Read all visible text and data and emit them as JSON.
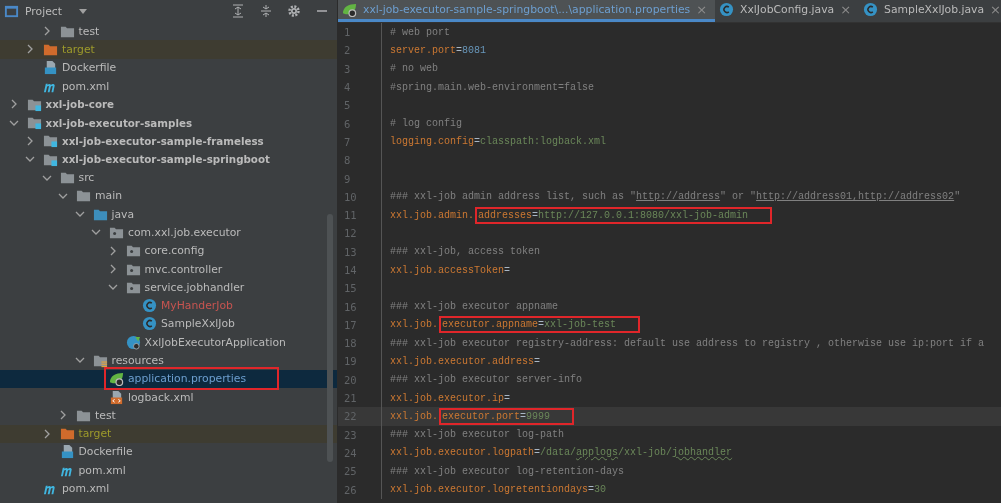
{
  "project_panel": {
    "title": "Project",
    "tree": [
      {
        "kind": "offscreen",
        "children": [
          {
            "kind": "offscreen",
            "children": [
              {
                "kind": "offscreen",
                "children": [
                  {
                    "kind": "folder",
                    "label": "test",
                    "expanded": false,
                    "selected": false,
                    "marked": false
                  }
                ]
              },
              {
                "kind": "target",
                "label": "target",
                "expanded": false,
                "selected": false,
                "marked": false
              },
              {
                "kind": "docker",
                "label": "Dockerfile",
                "selected": false,
                "marked": false
              },
              {
                "kind": "maven",
                "label": "pom.xml",
                "selected": false,
                "marked": false
              }
            ]
          },
          {
            "kind": "module",
            "label": "xxl-job-core",
            "expanded": false,
            "selected": false,
            "marked": false
          },
          {
            "kind": "module",
            "label": "xxl-job-executor-samples",
            "expanded": true,
            "selected": false,
            "marked": false,
            "children": [
              {
                "kind": "module",
                "label": "xxl-job-executor-sample-frameless",
                "expanded": false,
                "selected": false,
                "marked": false
              },
              {
                "kind": "module",
                "label": "xxl-job-executor-sample-springboot",
                "expanded": true,
                "selected": false,
                "marked": false,
                "children": [
                  {
                    "kind": "folder",
                    "label": "src",
                    "expanded": true,
                    "selected": false,
                    "marked": false,
                    "children": [
                      {
                        "kind": "folder",
                        "label": "main",
                        "expanded": true,
                        "selected": false,
                        "marked": false,
                        "children": [
                          {
                            "kind": "source",
                            "label": "java",
                            "expanded": true,
                            "selected": false,
                            "marked": false,
                            "children": [
                              {
                                "kind": "package",
                                "label": "com.xxl.job.executor",
                                "expanded": true,
                                "selected": false,
                                "marked": false,
                                "children": [
                                  {
                                    "kind": "package",
                                    "label": "core.config",
                                    "expanded": false,
                                    "selected": false,
                                    "marked": false
                                  },
                                  {
                                    "kind": "package",
                                    "label": "mvc.controller",
                                    "expanded": false,
                                    "selected": false,
                                    "marked": false
                                  },
                                  {
                                    "kind": "package",
                                    "label": "service.jobhandler",
                                    "expanded": true,
                                    "selected": false,
                                    "marked": false,
                                    "children": [
                                      {
                                        "kind": "class-new",
                                        "label": "MyHanderJob",
                                        "selected": false,
                                        "marked": false
                                      },
                                      {
                                        "kind": "class",
                                        "label": "SampleXxlJob",
                                        "selected": false,
                                        "marked": false
                                      }
                                    ]
                                  },
                                  {
                                    "kind": "spring-app",
                                    "label": "XxlJobExecutorApplication",
                                    "selected": false,
                                    "marked": false
                                  }
                                ]
                              }
                            ]
                          },
                          {
                            "kind": "resources",
                            "label": "resources",
                            "expanded": true,
                            "selected": false,
                            "marked": false,
                            "children": [
                              {
                                "kind": "properties",
                                "label": "application.properties",
                                "selected": true,
                                "marked": true
                              },
                              {
                                "kind": "xml",
                                "label": "logback.xml",
                                "selected": false,
                                "marked": false
                              }
                            ]
                          }
                        ]
                      },
                      {
                        "kind": "folder",
                        "label": "test",
                        "expanded": false,
                        "selected": false,
                        "marked": false
                      }
                    ]
                  },
                  {
                    "kind": "target",
                    "label": "target",
                    "expanded": false,
                    "selected": false,
                    "marked": false
                  },
                  {
                    "kind": "docker",
                    "label": "Dockerfile",
                    "selected": false,
                    "marked": false
                  },
                  {
                    "kind": "maven",
                    "label": "pom.xml",
                    "selected": false,
                    "marked": false
                  }
                ]
              },
              {
                "kind": "maven",
                "label": "pom.xml",
                "selected": false,
                "marked": false
              }
            ]
          }
        ]
      }
    ]
  },
  "editor": {
    "tabs": [
      {
        "kind": "properties",
        "label": "xxl-job-executor-sample-springboot\\...\\application.properties",
        "close": "×",
        "selected": true
      },
      {
        "kind": "class",
        "label": "XxlJobConfig.java",
        "close": "×",
        "selected": false
      },
      {
        "kind": "class",
        "label": "SampleXxlJob.java",
        "close": "×",
        "selected": false
      }
    ],
    "lines": [
      {
        "number": "1",
        "current": false,
        "tokens": [
          {
            "kind": "comment",
            "text": "# web port"
          }
        ]
      },
      {
        "number": "2",
        "current": false,
        "tokens": [
          {
            "kind": "key",
            "text": "server.port"
          },
          {
            "kind": "op",
            "text": "="
          },
          {
            "kind": "number",
            "text": "8081"
          }
        ]
      },
      {
        "number": "3",
        "current": false,
        "tokens": [
          {
            "kind": "comment",
            "text": "# no web"
          }
        ]
      },
      {
        "number": "4",
        "current": false,
        "tokens": [
          {
            "kind": "comment",
            "text": "#spring.main.web-environment=false"
          }
        ]
      },
      {
        "number": "5",
        "current": false
      },
      {
        "number": "6",
        "current": false,
        "tokens": [
          {
            "kind": "comment",
            "text": "# log config"
          }
        ]
      },
      {
        "number": "7",
        "current": false,
        "tokens": [
          {
            "kind": "key",
            "text": "logging.config"
          },
          {
            "kind": "op",
            "text": "="
          },
          {
            "kind": "value",
            "text": "classpath:logback.xml"
          }
        ]
      },
      {
        "number": "8",
        "current": false
      },
      {
        "number": "9",
        "current": false
      },
      {
        "number": "10",
        "current": false,
        "tokens": [
          {
            "kind": "comment",
            "text": "### xxl-job admin address list, such as \""
          },
          {
            "kind": "link",
            "text": "http://address"
          },
          {
            "kind": "comment",
            "text": "\" or \""
          },
          {
            "kind": "link",
            "text": "http://address01,http://address02"
          },
          {
            "kind": "comment",
            "text": "\""
          }
        ]
      },
      {
        "number": "11",
        "current": false,
        "tokens": [
          {
            "kind": "key",
            "text": "xxl.job.admin."
          },
          {
            "kind": "marked",
            "tokens": [
              {
                "kind": "key",
                "text": "addresses"
              },
              {
                "kind": "op",
                "text": "="
              },
              {
                "kind": "value",
                "text": "http://127.0.0.1:8080/xxl-job-admin"
              }
            ]
          }
        ]
      },
      {
        "number": "12",
        "current": false
      },
      {
        "number": "13",
        "current": false,
        "tokens": [
          {
            "kind": "comment",
            "text": "### xxl-job, access token"
          }
        ]
      },
      {
        "number": "14",
        "current": false,
        "tokens": [
          {
            "kind": "key",
            "text": "xxl.job.accessToken"
          },
          {
            "kind": "op",
            "text": "="
          }
        ]
      },
      {
        "number": "15",
        "current": false
      },
      {
        "number": "16",
        "current": false,
        "tokens": [
          {
            "kind": "comment",
            "text": "### xxl-job executor appname"
          }
        ]
      },
      {
        "number": "17",
        "current": false,
        "tokens": [
          {
            "kind": "key",
            "text": "xxl.job."
          },
          {
            "kind": "marked",
            "tokens": [
              {
                "kind": "key",
                "text": "executor.appname"
              },
              {
                "kind": "op",
                "text": "="
              },
              {
                "kind": "value",
                "text": "xxl-job-test"
              }
            ]
          }
        ]
      },
      {
        "number": "18",
        "current": false,
        "tokens": [
          {
            "kind": "comment",
            "text": "### xxl-job executor registry-address: default use address to registry , otherwise use ip:port if a"
          }
        ]
      },
      {
        "number": "19",
        "current": false,
        "tokens": [
          {
            "kind": "key",
            "text": "xxl.job.executor.address"
          },
          {
            "kind": "op",
            "text": "="
          }
        ]
      },
      {
        "number": "20",
        "current": false,
        "tokens": [
          {
            "kind": "comment",
            "text": "### xxl-job executor server-info"
          }
        ]
      },
      {
        "number": "21",
        "current": false,
        "tokens": [
          {
            "kind": "key",
            "text": "xxl.job.executor.ip"
          },
          {
            "kind": "op",
            "text": "="
          }
        ]
      },
      {
        "number": "22",
        "current": true,
        "tokens": [
          {
            "kind": "key",
            "text": "xxl.job."
          },
          {
            "kind": "marked",
            "tokens": [
              {
                "kind": "key",
                "text": "executor.port"
              },
              {
                "kind": "op",
                "text": "="
              },
              {
                "kind": "value",
                "text": "9999"
              }
            ]
          }
        ]
      },
      {
        "number": "23",
        "current": false,
        "tokens": [
          {
            "kind": "comment",
            "text": "### xxl-job executor log-path"
          }
        ]
      },
      {
        "number": "24",
        "current": false,
        "tokens": [
          {
            "kind": "key",
            "text": "xxl.job.executor.logpath"
          },
          {
            "kind": "op",
            "text": "="
          },
          {
            "kind": "value",
            "text": "/data/"
          },
          {
            "kind": "typo",
            "text": "applogs"
          },
          {
            "kind": "value",
            "text": "/xxl-job/"
          },
          {
            "kind": "typo",
            "text": "jobhandler"
          }
        ]
      },
      {
        "number": "25",
        "current": false,
        "tokens": [
          {
            "kind": "comment",
            "text": "### xxl-job executor log-retention-days"
          }
        ]
      },
      {
        "number": "26",
        "current": false,
        "tokens": [
          {
            "kind": "key",
            "text": "xxl.job.executor.logretentiondays"
          },
          {
            "kind": "op",
            "text": "="
          },
          {
            "kind": "value",
            "text": "30"
          }
        ]
      }
    ]
  }
}
